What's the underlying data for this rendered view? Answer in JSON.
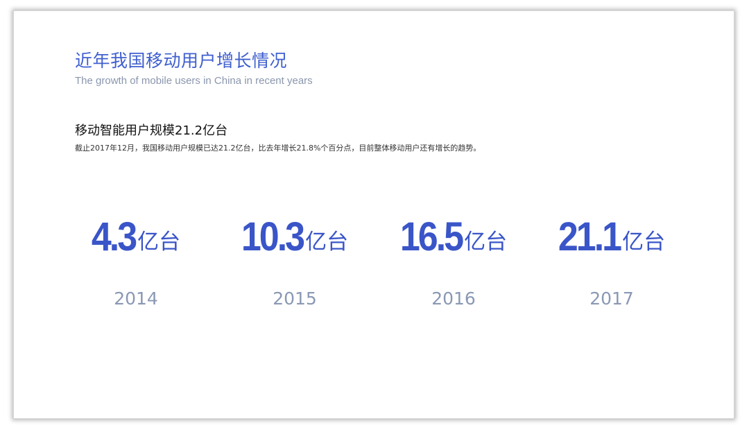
{
  "header": {
    "title": "近年我国移动用户增长情况",
    "subtitle": "The growth of mobile users in China in recent years"
  },
  "section": {
    "title": "移动智能用户规模21.2亿台",
    "description": "截止2017年12月，我国移动用户规模已达21.2亿台，比去年增长21.8%个百分点，目前整体移动用户还有增长的趋势。"
  },
  "stats": [
    {
      "value": "4.3",
      "unit": "亿台",
      "year": "2014"
    },
    {
      "value": "10.3",
      "unit": "亿台",
      "year": "2015"
    },
    {
      "value": "16.5",
      "unit": "亿台",
      "year": "2016"
    },
    {
      "value": "21.1",
      "unit": "亿台",
      "year": "2017"
    }
  ],
  "colors": {
    "accent": "#3a55c8",
    "title": "#3f5fcf",
    "muted": "#8a98b4"
  }
}
